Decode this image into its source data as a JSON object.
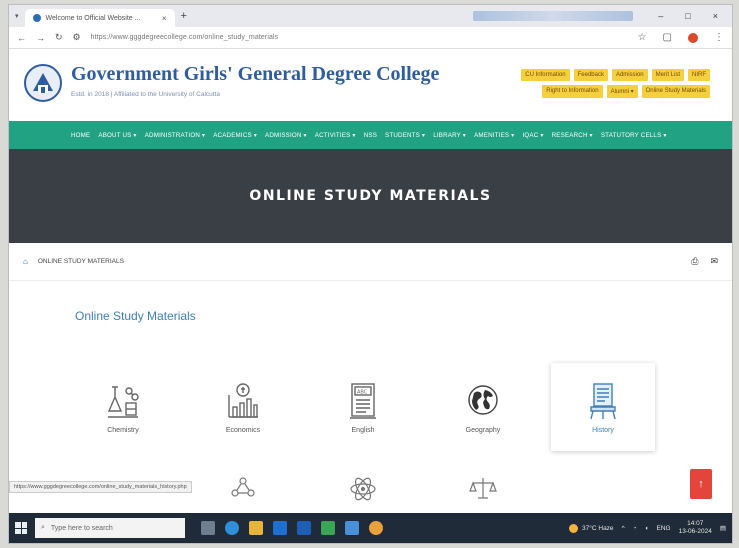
{
  "browser": {
    "tab_title": "Welcome to Official Website ...",
    "url": "https://www.gggdegreecollege.com/online_study_materials",
    "new_tab_glyph": "+",
    "close_glyph": "×",
    "minimize_glyph": "–",
    "maximize_glyph": "□",
    "window_close_glyph": "×"
  },
  "site": {
    "college_name": "Government Girls' General Degree College",
    "college_subtitle": "Estd. in 2018 | Affiliated to the University of Calcutta",
    "quick_links": [
      "CU Information",
      "Feedback",
      "Admission",
      "Merit List",
      "NIRF",
      "Right to Information",
      "Alumni ▾",
      "Online Study Materials"
    ],
    "nav": [
      "HOME",
      "ABOUT US ▾",
      "ADMINISTRATION ▾",
      "ACADEMICS ▾",
      "ADMISSION ▾",
      "ACTIVITIES ▾",
      "NSS",
      "STUDENTS ▾",
      "LIBRARY ▾",
      "AMENITIES ▾",
      "IQAC ▾",
      "RESEARCH ▾",
      "STATUTORY CELLS ▾"
    ]
  },
  "banner": {
    "title": "ONLINE STUDY MATERIALS"
  },
  "breadcrumb": {
    "current": "ONLINE STUDY MATERIALS"
  },
  "content": {
    "section_title": "Online Study Materials",
    "subjects": [
      {
        "label": "Chemistry",
        "icon": "chemistry-icon"
      },
      {
        "label": "Economics",
        "icon": "economics-icon"
      },
      {
        "label": "English",
        "icon": "english-icon"
      },
      {
        "label": "Geography",
        "icon": "geography-icon"
      },
      {
        "label": "History",
        "icon": "history-icon"
      }
    ],
    "status_url": "https://www.gggdegreecollege.com/online_study_materials_history.php"
  },
  "taskbar": {
    "search_placeholder": "Type here to search",
    "weather": "37°C Haze",
    "language": "ENG",
    "time": "14:07",
    "date": "13-06-2024"
  },
  "colors": {
    "nav_green": "#21a383",
    "banner_dark": "#3a3e45",
    "title_blue": "#2e5d9f",
    "accent_yellow": "#f4d03f",
    "scroll_red": "#e4453a"
  }
}
